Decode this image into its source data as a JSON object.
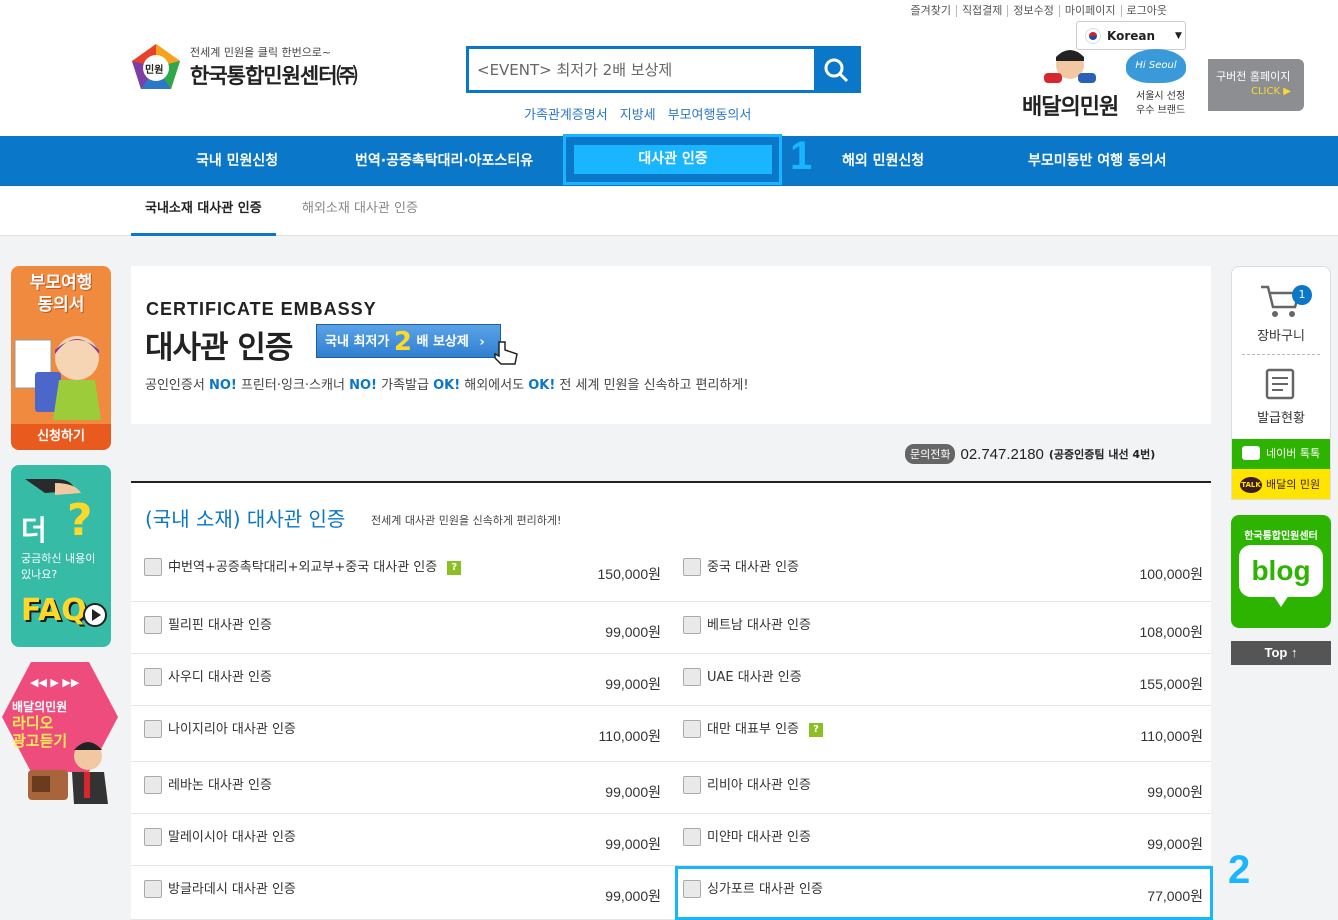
{
  "header": {
    "top_links": [
      "즐겨찾기",
      "직접결제",
      "정보수정",
      "마이페이지",
      "로그아웃"
    ],
    "logo_tagline": "전세계 민원을 클릭 한번으로~",
    "logo_name": "한국통합민원센터㈜",
    "logo_mark": "민원",
    "search_value": "<EVENT> 최저가 2배 보상제",
    "quick_links": [
      "가족관계증명서",
      "지방세",
      "부모여행동의서"
    ],
    "language": "Korean",
    "baedal_name": "배달의민원",
    "baedal_sub": [
      "서울시 선정",
      "우수 브랜드"
    ],
    "hiseoul": "Hi Seoul",
    "old_home": "구버전 홈페이지",
    "old_home_click": "CLICK ▶"
  },
  "gnb": {
    "items": [
      "국내 민원신청",
      "번역·공증촉탁대리·아포스티유",
      "대사관 인증",
      "해외 민원신청",
      "부모미동반 여행 동의서"
    ],
    "marker_1": "1"
  },
  "subnav": {
    "tabs": [
      "국내소재 대사관 인증",
      "해외소재 대사관 인증"
    ]
  },
  "left_banners": {
    "b1_title": "부모여행 동의서",
    "b1_button": "신청하기",
    "b2_big": "더",
    "b2_q": "?",
    "b2_text": "궁금하신 내용이 있나요?",
    "b2_faq": "FAQ",
    "b3_t1": "배달의민원",
    "b3_t2": "라디오 광고듣기"
  },
  "banner": {
    "title_en": "CERTIFICATE EMBASSY",
    "title_ko": "대사관 인증",
    "badge_pre": "국내 최저가",
    "badge_num": "2",
    "badge_post": "배 보상제",
    "desc_parts": [
      "공인인증서",
      "NO!",
      "프린터·잉크·스캐너",
      "NO!",
      "가족발급",
      "OK!",
      "해외에서도",
      "OK!",
      "전 세계 민원을 신속하고 편리하게!"
    ]
  },
  "contact": {
    "label": "문의전화",
    "number": "02.747.2180",
    "note": "(공증인증팀 내선 4번)"
  },
  "list": {
    "title": "(국내 소재) 대사관 인증",
    "subtitle": "전세계 대사관 민원을 신속하게 편리하게!",
    "rows": [
      [
        {
          "name": "中번역+공증촉탁대리+외교부+중국 대사관 인증",
          "price": "150,000원",
          "help": "?"
        },
        {
          "name": "중국 대사관 인증",
          "price": "100,000원"
        }
      ],
      [
        {
          "name": "필리핀 대사관 인증",
          "price": "99,000원"
        },
        {
          "name": "베트남 대사관 인증",
          "price": "108,000원"
        }
      ],
      [
        {
          "name": "사우디 대사관 인증",
          "price": "99,000원"
        },
        {
          "name": "UAE 대사관 인증",
          "price": "155,000원"
        }
      ],
      [
        {
          "name": "나이지리아 대사관 인증",
          "price": "110,000원"
        },
        {
          "name": "대만 대표부 인증",
          "price": "110,000원",
          "help": "?"
        }
      ],
      [
        {
          "name": "레바논 대사관 인증",
          "price": "99,000원"
        },
        {
          "name": "리비아 대사관 인증",
          "price": "99,000원"
        }
      ],
      [
        {
          "name": "말레이시아 대사관 인증",
          "price": "99,000원"
        },
        {
          "name": "미얀마 대사관 인증",
          "price": "99,000원"
        }
      ],
      [
        {
          "name": "방글라데시 대사관 인증",
          "price": "99,000원"
        },
        {
          "name": "싱가포르 대사관 인증",
          "price": "77,000원"
        }
      ]
    ],
    "marker_2": "2"
  },
  "right_quick": {
    "cart_label": "장바구니",
    "cart_count": "1",
    "issue_label": "발급현황",
    "naver": "네이버 톡톡",
    "kakao_icon": "TALK",
    "kakao": "배달의 민원",
    "blog_title": "한국통합민원센터",
    "blog_text": "blog",
    "top": "Top ↑"
  }
}
